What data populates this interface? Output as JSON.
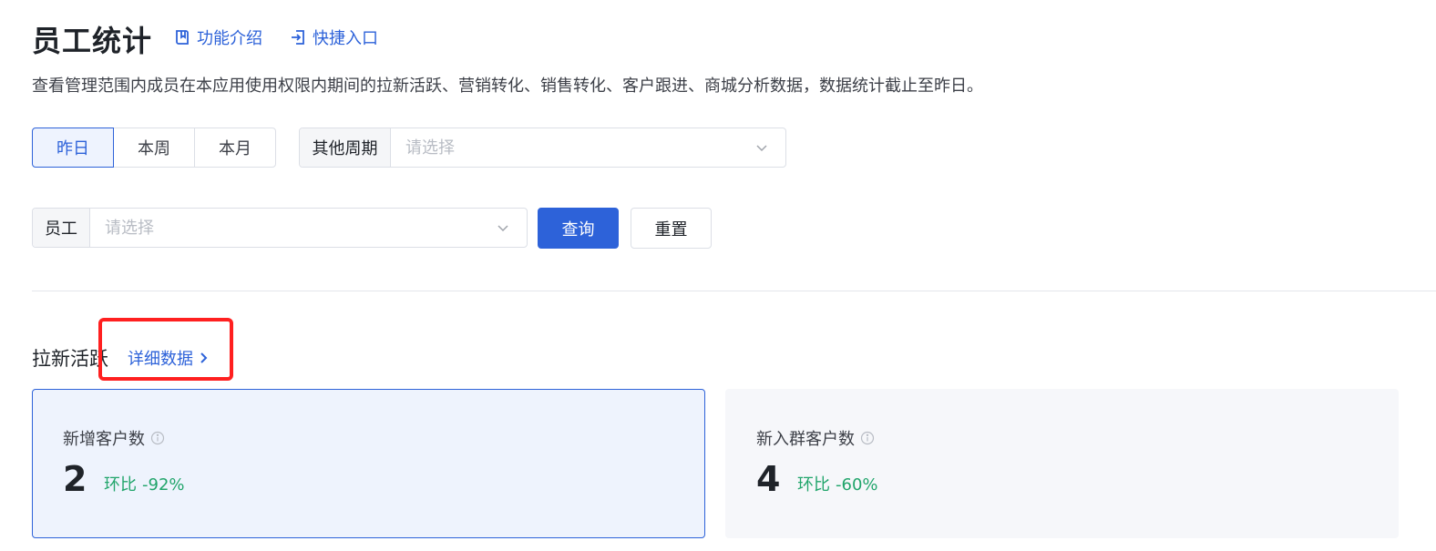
{
  "header": {
    "title": "员工统计",
    "links": [
      {
        "label": "功能介绍",
        "icon": "book-icon"
      },
      {
        "label": "快捷入口",
        "icon": "enter-icon"
      }
    ],
    "description": "查看管理范围内成员在本应用使用权限内期间的拉新活跃、营销转化、销售转化、客户跟进、商城分析数据，数据统计截止至昨日。"
  },
  "filters": {
    "period_tabs": [
      {
        "label": "昨日",
        "active": true
      },
      {
        "label": "本周",
        "active": false
      },
      {
        "label": "本月",
        "active": false
      }
    ],
    "other_period": {
      "prefix": "其他周期",
      "placeholder": "请选择"
    },
    "employee": {
      "prefix": "员工",
      "placeholder": "请选择"
    },
    "query_label": "查询",
    "reset_label": "重置"
  },
  "section": {
    "title": "拉新活跃",
    "detail_link": "详细数据",
    "cards": [
      {
        "label": "新增客户数",
        "value": "2",
        "change_label": "环比",
        "change_value": "-92%",
        "selected": true
      },
      {
        "label": "新入群客户数",
        "value": "4",
        "change_label": "环比",
        "change_value": "-60%",
        "selected": false
      }
    ]
  },
  "colors": {
    "accent": "#2d62d9",
    "positive_change": "#21a56b",
    "highlight": "#ff2020"
  }
}
